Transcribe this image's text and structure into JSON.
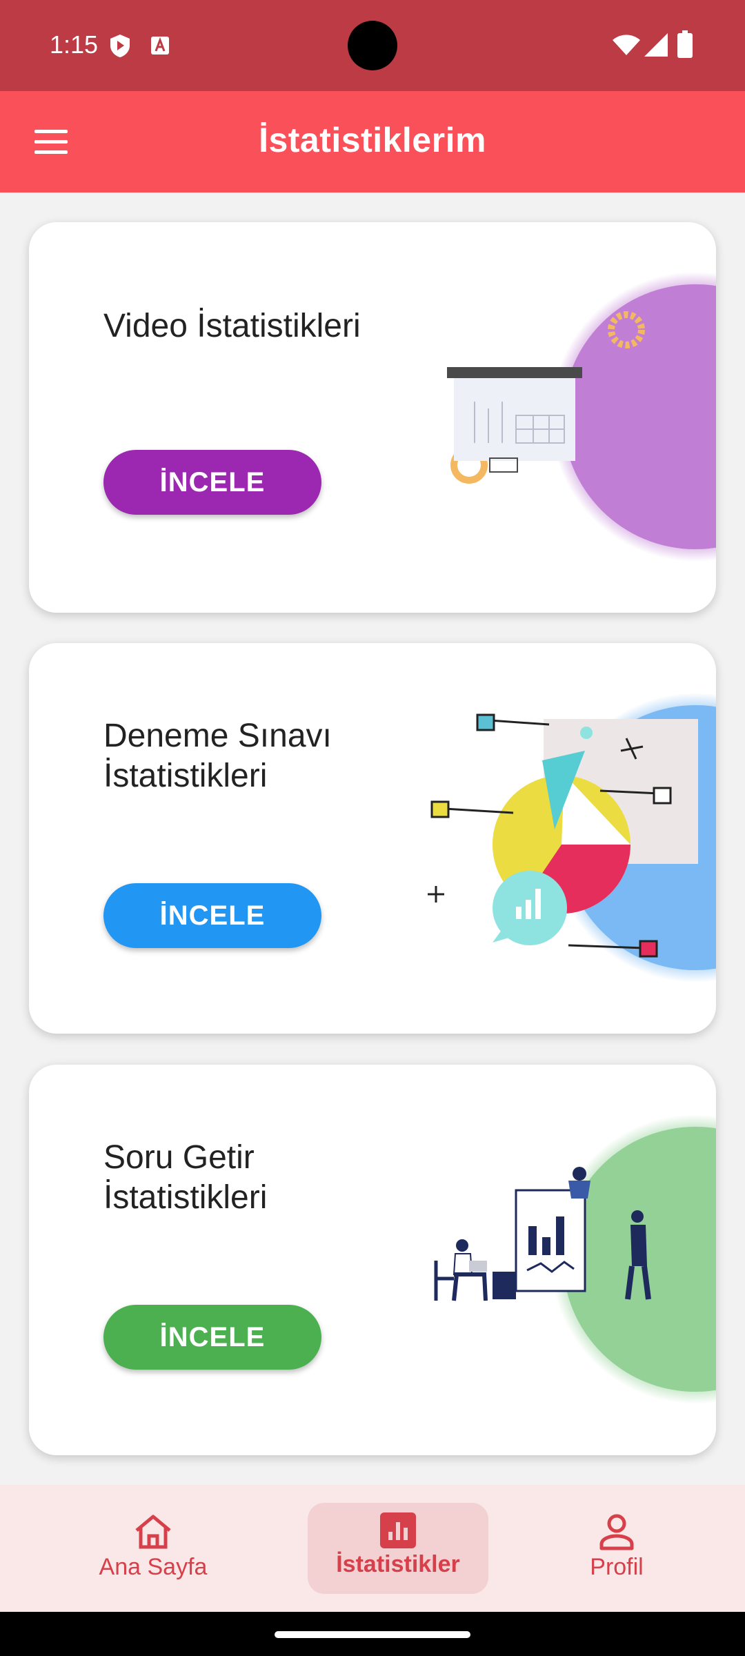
{
  "status_bar": {
    "time": "1:15"
  },
  "app_bar": {
    "title": "İstatistiklerim"
  },
  "cards": [
    {
      "title": "Video İstatistikleri",
      "button_label": "İNCELE",
      "accent": "#9c27b0"
    },
    {
      "title": "Deneme Sınavı İstatistikleri",
      "button_label": "İNCELE",
      "accent": "#2196f3"
    },
    {
      "title": "Soru Getir İstatistikleri",
      "button_label": "İNCELE",
      "accent": "#4caf50"
    }
  ],
  "bottom_nav": {
    "items": [
      {
        "label": "Ana Sayfa",
        "icon": "home-icon",
        "active": false
      },
      {
        "label": "İstatistikler",
        "icon": "bar-chart-icon",
        "active": true
      },
      {
        "label": "Profil",
        "icon": "person-icon",
        "active": false
      }
    ]
  },
  "colors": {
    "status_bar": "#bd3b44",
    "app_bar": "#fa505a",
    "nav_background": "#fae8e8",
    "nav_accent": "#d6404a"
  }
}
